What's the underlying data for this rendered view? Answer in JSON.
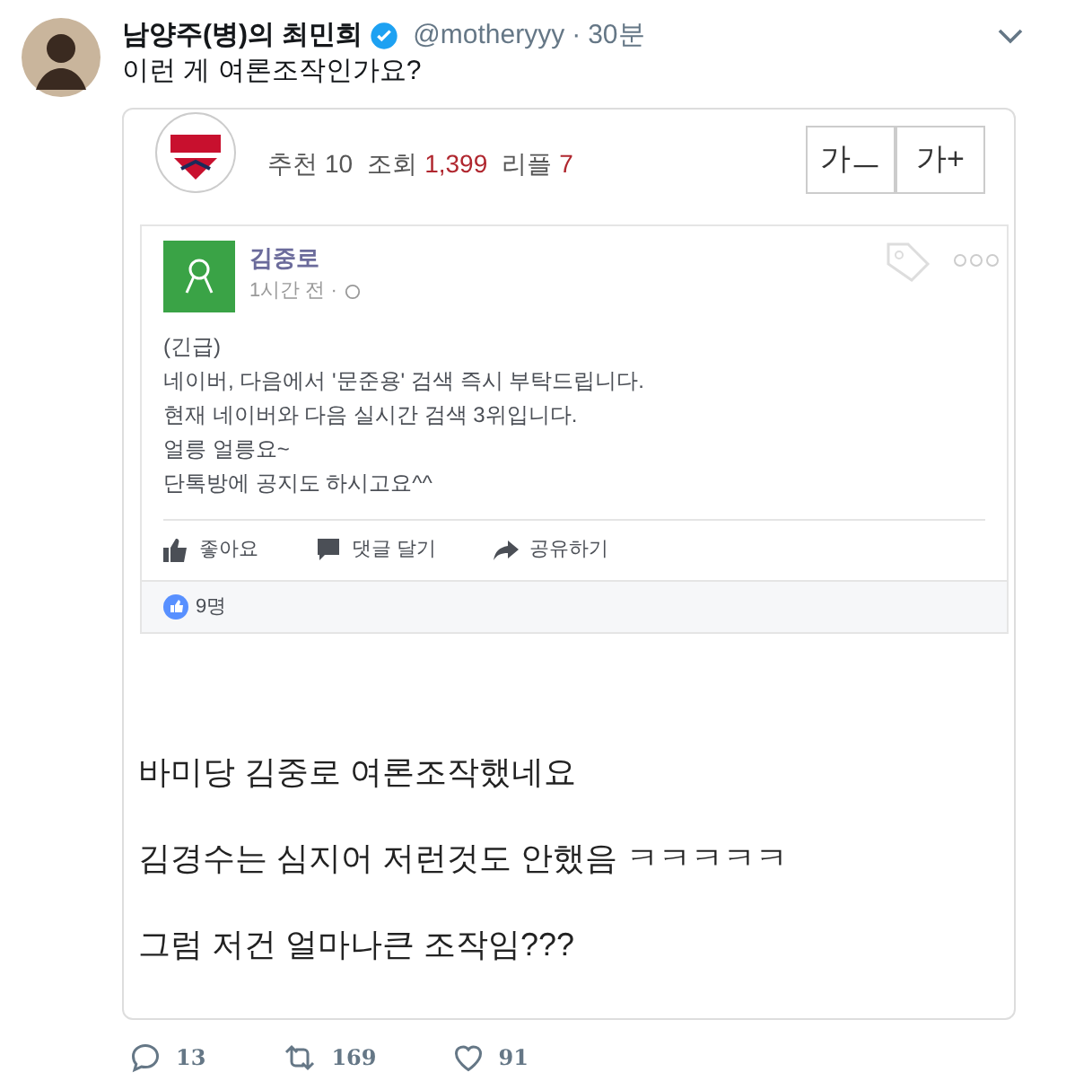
{
  "tweet": {
    "author": "남양주(병)의 최민희",
    "verified": true,
    "handle": "@motheryyy",
    "separator": "·",
    "time": "30분",
    "text": "이런 게 여론조작인가요?"
  },
  "forum": {
    "stats": [
      {
        "label": "추천",
        "value": "10",
        "highlight": false
      },
      {
        "label": "조회",
        "value": "1,399",
        "highlight": true
      },
      {
        "label": "리플",
        "value": "7",
        "highlight": true
      }
    ],
    "font_buttons": [
      "가ㅡ",
      "가+"
    ]
  },
  "facebook_post": {
    "author": "김중로",
    "time": "1시간 전 ·",
    "lines": [
      "(긴급)",
      "네이버, 다음에서 '문준용' 검색 즉시 부탁드립니다.",
      "현재 네이버와 다음 실시간 검색 3위입니다.",
      "얼릉 얼릉요~",
      "단톡방에 공지도 하시고요^^"
    ],
    "actions": [
      {
        "kind": "like",
        "label": "좋아요"
      },
      {
        "kind": "comment",
        "label": "댓글 달기"
      },
      {
        "kind": "share",
        "label": "공유하기"
      }
    ],
    "reactions": "9명"
  },
  "body_lines": [
    "바미당 김중로 여론조작했네요",
    "김경수는 심지어 저런것도 안했음 ㅋㅋㅋㅋㅋ",
    "그럼 저건 얼마나큰 조작임???"
  ],
  "tweet_actions": [
    {
      "kind": "reply",
      "count": "13"
    },
    {
      "kind": "retweet",
      "count": "169"
    },
    {
      "kind": "like",
      "count": "91"
    }
  ]
}
